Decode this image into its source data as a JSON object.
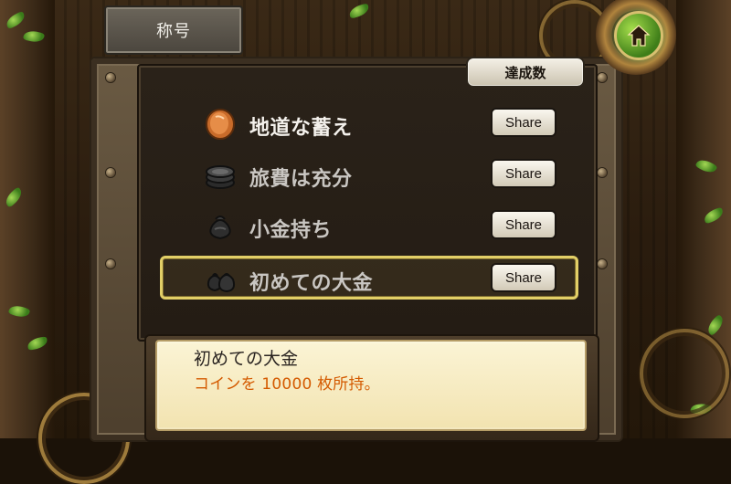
{
  "header": {
    "title": "称号",
    "home_icon": "home-icon"
  },
  "toolbar": {
    "counter_label": "達成数"
  },
  "achievements": {
    "items": [
      {
        "name": "地道な蓄え",
        "share": "Share",
        "icon": "copper-coin-icon",
        "selected": false
      },
      {
        "name": "旅費は充分",
        "share": "Share",
        "icon": "coin-stack-icon",
        "selected": false
      },
      {
        "name": "小金持ち",
        "share": "Share",
        "icon": "money-bag-icon",
        "selected": false
      },
      {
        "name": "初めての大金",
        "share": "Share",
        "icon": "money-bags-icon",
        "selected": true
      }
    ]
  },
  "detail": {
    "title": "初めての大金",
    "description": "コインを 10000 枚所持。"
  },
  "colors": {
    "accent_selected": "#e2cf67",
    "description_text": "#d45a00",
    "title_text": "#2a2421"
  }
}
